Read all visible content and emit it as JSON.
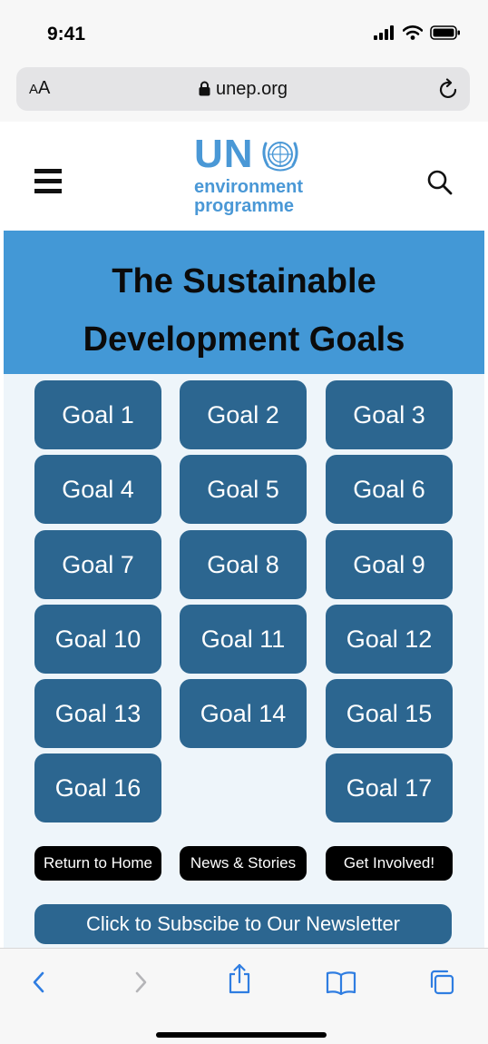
{
  "status_bar": {
    "time": "9:41"
  },
  "browser": {
    "text_size_label": "AA",
    "domain": "unep.org"
  },
  "site": {
    "logo": {
      "un": "UN",
      "line1": "environment",
      "line2": "programme"
    }
  },
  "hero": {
    "line1": "The Sustainable",
    "line2": "Development Goals"
  },
  "goals": [
    "Goal 1",
    "Goal 2",
    "Goal 3",
    "Goal 4",
    "Goal 5",
    "Goal 6",
    "Goal 7",
    "Goal 8",
    "Goal 9",
    "Goal 10",
    "Goal 11",
    "Goal 12",
    "Goal 13",
    "Goal 14",
    "Goal 15",
    "Goal 16",
    "Goal 17"
  ],
  "links": {
    "home": "Return to Home",
    "news": "News & Stories",
    "involved": "Get Involved!"
  },
  "newsletter": "Click to Subscibe to Our Newsletter",
  "colors": {
    "hero_bg": "#4398d6",
    "goal_button": "#2c6690",
    "logo_blue": "#4a98d6",
    "goals_bg": "#eef5fa",
    "toolbar_icon": "#2f7de1"
  },
  "icons": {
    "menu": "hamburger-menu-icon",
    "search": "search-icon",
    "lock": "lock-icon",
    "reload": "reload-icon",
    "back": "chevron-left-icon",
    "forward": "chevron-right-icon",
    "share": "share-icon",
    "bookmarks": "book-icon",
    "tabs": "tabs-icon"
  }
}
